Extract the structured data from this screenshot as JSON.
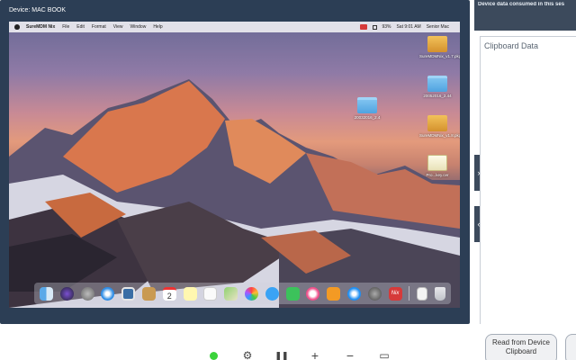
{
  "device": {
    "title": "Device: MAC BOOK"
  },
  "menubar": {
    "items": [
      "SureMDM Nix",
      "File",
      "Edit",
      "Format",
      "View",
      "Window",
      "Help"
    ],
    "battery": "93%",
    "time": "Sat 9:01 AM",
    "user": "Senior Mac"
  },
  "desktop": {
    "icons": [
      {
        "label": "SureMDMNix_v1.7.pkg",
        "kind": "package-icon"
      },
      {
        "label": "20052016_2.44",
        "kind": "folder-icon"
      },
      {
        "label": "20032016_2.4",
        "kind": "folder-icon"
      },
      {
        "label": "SureMDMNix_v1.8.pkg",
        "kind": "package-icon"
      },
      {
        "label": "Pro...key.cer",
        "kind": "certificate-icon"
      }
    ]
  },
  "dock": {
    "icons": [
      "finder-icon",
      "siri-icon",
      "launchpad-icon",
      "safari-icon",
      "preview-icon",
      "notes-book-icon",
      "calendar-icon",
      "notes-icon",
      "reminders-icon",
      "maps-icon",
      "photos-icon",
      "messages-icon",
      "facetime-icon",
      "itunes-icon",
      "ibooks-icon",
      "app-store-icon",
      "system-preferences-icon",
      "nix-agent-icon",
      "document-icon",
      "trash-icon"
    ],
    "calendar_day": "2",
    "nix_label": "Nix"
  },
  "right_panel": {
    "top_title": "Device data consumed in this ses",
    "clipboard_title": "Clipboard Data",
    "read_button": "Read from Device Clipboard",
    "expand_tab": "›",
    "collapse_tab": "‹"
  },
  "toolbar": {
    "icons": [
      "status-green-icon",
      "settings-icon",
      "pause-icon",
      "zoom-in-icon",
      "zoom-out-icon",
      "screen-icon"
    ],
    "settings": "⚙",
    "pause": "❚❚",
    "zoom_in": "+",
    "zoom_out": "−",
    "screen": "▭"
  },
  "colors": {
    "frame": "#2c3e55",
    "accent_panel": "#3c4a5c",
    "status_green": "#3bd33b",
    "nix_red": "#d63a3a"
  }
}
